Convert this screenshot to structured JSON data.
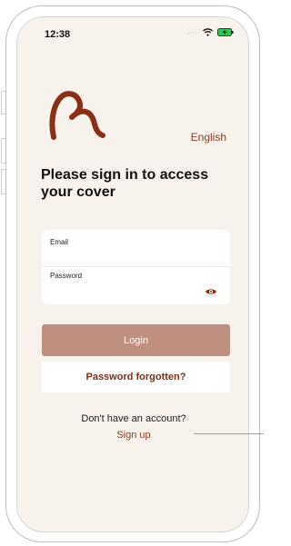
{
  "status_bar": {
    "time": "12:38",
    "signal_dots": "....",
    "wifi_icon": "wifi-icon",
    "battery_icon": "battery-charging-icon",
    "battery_color": "#2dc653"
  },
  "brand": {
    "logo_icon": "brand-logo-icon",
    "logo_color": "#8a2f17"
  },
  "language": {
    "label": "English"
  },
  "heading": "Please sign in to access your cover",
  "form": {
    "email": {
      "label": "Email",
      "value": "",
      "placeholder": ""
    },
    "password": {
      "label": "Password",
      "value": "",
      "placeholder": "",
      "toggle_icon": "eye-icon"
    }
  },
  "actions": {
    "login_label": "Login",
    "forgot_label": "Password forgotten?"
  },
  "footer": {
    "no_account_text": "Don't have an account?",
    "signup_label": "Sign up"
  },
  "colors": {
    "background": "#f7f2ec",
    "accent": "#8a3a1f",
    "login_button": "#bf8f7f",
    "callout_line": "#6cb3a8"
  }
}
